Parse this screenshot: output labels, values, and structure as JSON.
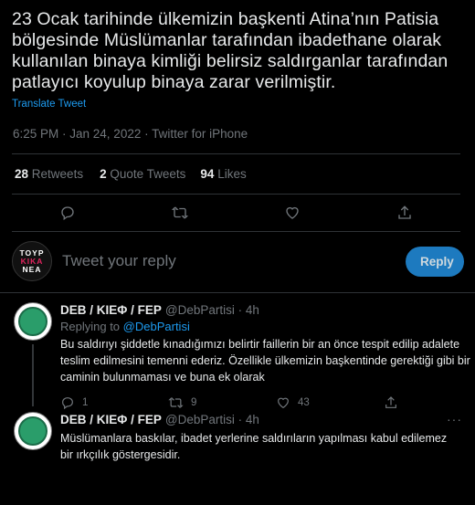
{
  "tweet": {
    "text": "23 Ocak tarihinde ülkemizin başkenti Atina’nın Patisia bölgesinde Müslümanlar tarafından ibadethane olarak kullanılan binaya kimliği belirsiz saldırganlar tarafından patlayıcı koyulup binaya zarar verilmiştir.",
    "translate_label": "Translate Tweet",
    "meta": "6:25 PM · Jan 24, 2022 · Twitter for iPhone",
    "stats": [
      {
        "num": "28",
        "label": "Retweets"
      },
      {
        "num": "2",
        "label": "Quote Tweets"
      },
      {
        "num": "94",
        "label": "Likes"
      }
    ],
    "actions": [
      "reply-icon",
      "retweet-icon",
      "like-icon",
      "share-icon"
    ]
  },
  "compose": {
    "avatar_lines": [
      "TOYP",
      "KIKA",
      "NEA"
    ],
    "placeholder": "Tweet your reply",
    "button": "Reply"
  },
  "replies": [
    {
      "name": "DEB / ΚΙΕΦ / FEP",
      "handle": "@DebPartisi · 4h",
      "replying_prefix": "Replying to",
      "replying_to": "@DebPartisi",
      "text": "Bu saldırıyı şiddetle kınadığımızı belirtir faillerin bir an önce tespit edilip adalete teslim edilmesini temenni ederiz. Özellikle ülkemizin başkentinde gerektiği gibi bir caminin bulunmaması ve buna ek olarak",
      "reply_count": "1",
      "retweet_count": "9",
      "like_count": "43"
    },
    {
      "name": "DEB / ΚΙΕΦ / FEP",
      "handle": "@DebPartisi · 4h",
      "text": "Müslümanlara baskılar, ibadet yerlerine saldırıların yapılması kabul edilemez bir ırkçılık göstergesidir."
    }
  ],
  "colors": {
    "background": "#000000",
    "accent": "#1d9bf0",
    "muted": "#71767b",
    "reply_button": "#1d7abf"
  }
}
